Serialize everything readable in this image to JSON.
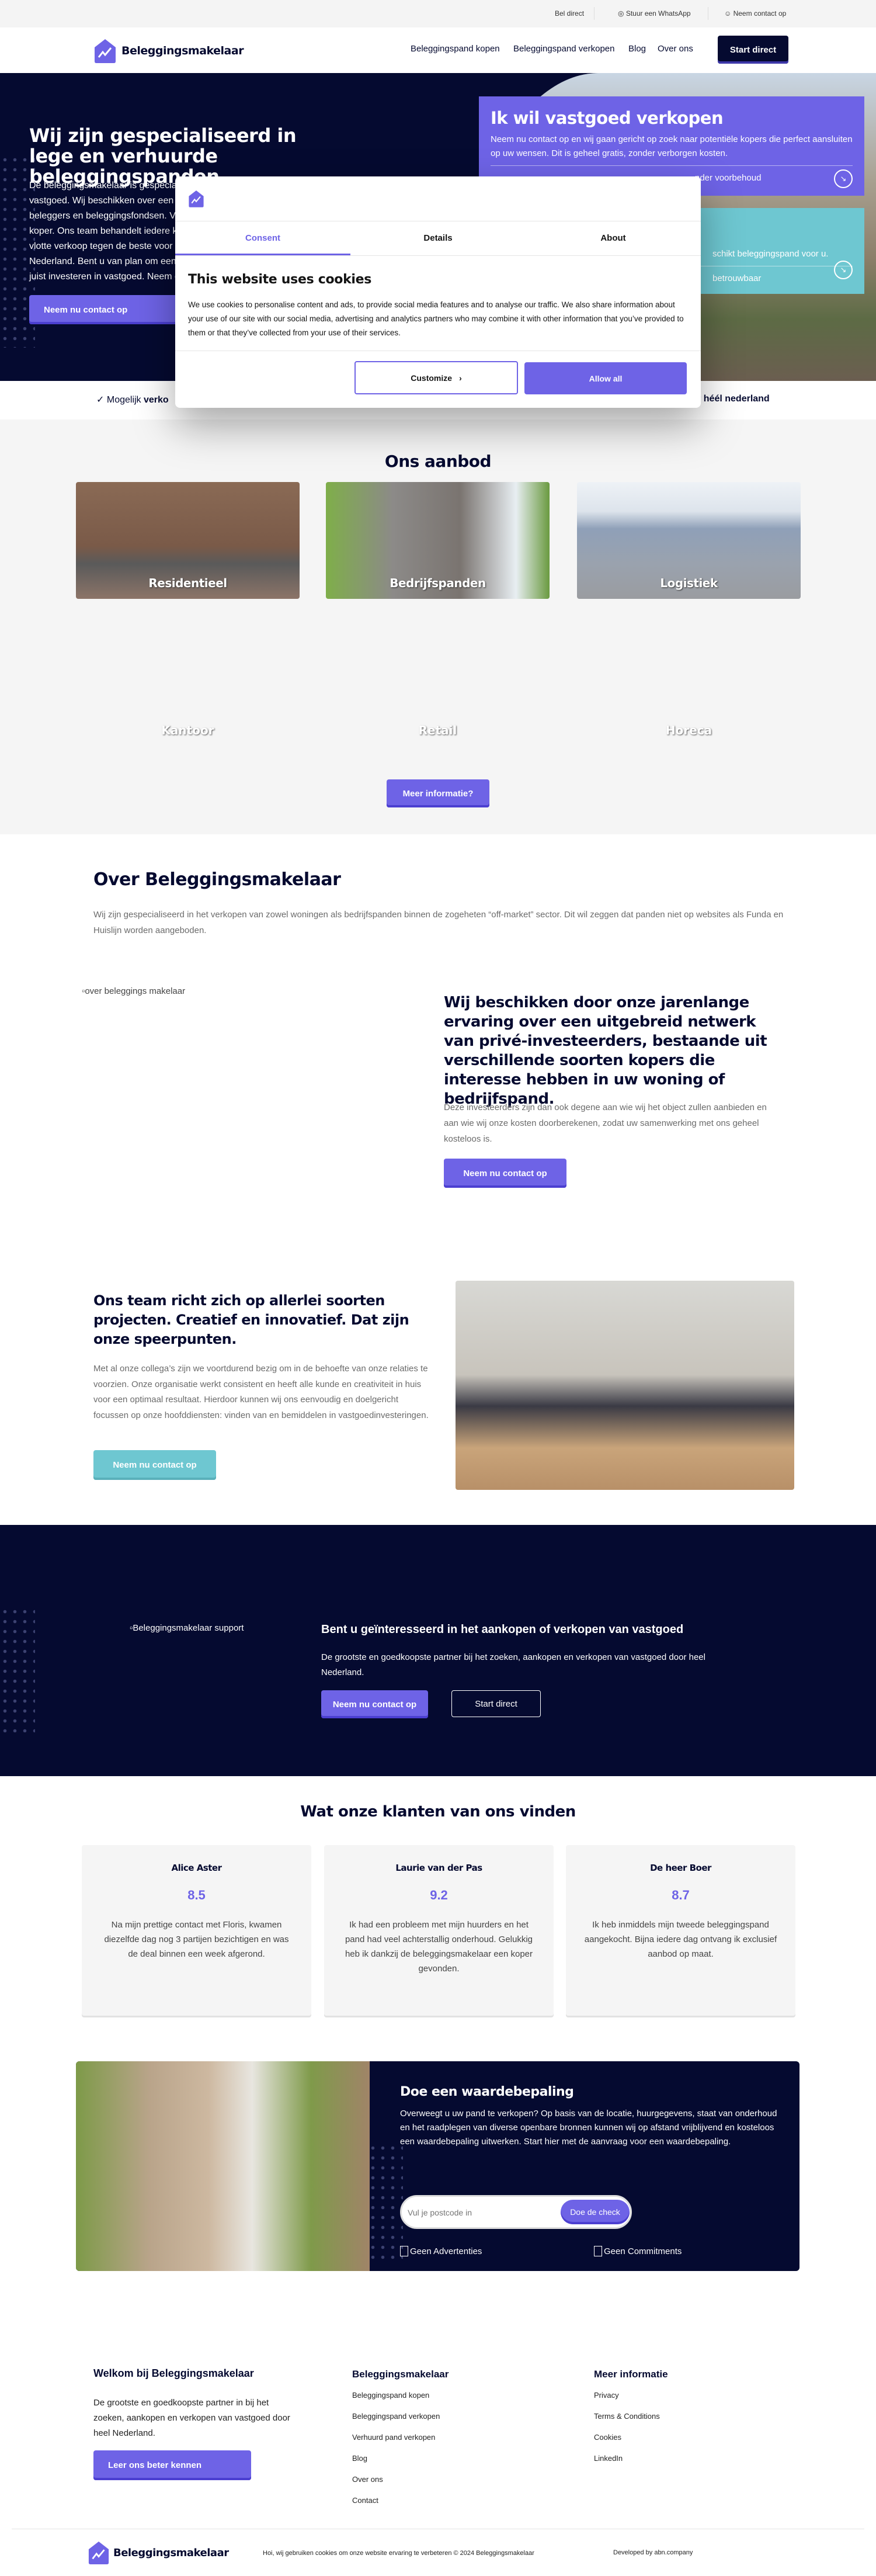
{
  "topbar": {
    "call": "Bel direct",
    "whatsapp": "Stuur een WhatsApp",
    "contact": "Neem contact op"
  },
  "nav": {
    "brand": "Beleggingsmakelaar",
    "links": [
      "Beleggingspand kopen",
      "Beleggingspand verkopen",
      "Blog",
      "Over ons"
    ],
    "cta": "Start direct"
  },
  "hero": {
    "title": "Wij zijn gespecialiseerd in lege en verhuurde beleggingspanden",
    "lines": [
      "De beleggingsmakelaar is gespecial",
      "vastgoed. Wij beschikken over een g",
      "beleggers en beleggingsfondsen. V",
      "koper. Ons team behandelt iedere k",
      "vlotte verkoop tegen de beste voor",
      "Nederland. Bent u van plan om een",
      "juist investeren in vastgoed. Neem c"
    ],
    "button": "Neem nu contact op",
    "sell": {
      "title": "Ik wil vastgoed verkopen",
      "text": "Neem nu contact op en wij gaan gericht op zoek naar potentiële kopers die perfect aansluiten op uw wensen. Dit is geheel gratis, zonder verborgen kosten.",
      "link": "nder voorbehoud"
    },
    "buy": {
      "text": "schikt beleggingspand voor u.",
      "link": "betrouwbaar"
    },
    "strip_left_a": "Mogelijk ",
    "strip_left_b": "verko",
    "strip_right_a": "r ",
    "strip_right_b": "héél nederland"
  },
  "aanbod": {
    "title": "Ons aanbod",
    "items": [
      "Residentieel",
      "Bedrijfspanden",
      "Logistiek",
      "Kantoor",
      "Retail",
      "Horeca"
    ],
    "button": "Meer informatie?"
  },
  "about": {
    "title": "Over Beleggingsmakelaar",
    "text": "Wij zijn gespecialiseerd in het verkopen van zowel woningen als bedrijfspanden binnen de zogeheten “off-market” sector. Dit wil zeggen dat panden niet op websites als Funda en Huislijn worden aangeboden.",
    "img_alt": "over beleggings makelaar",
    "heading": "Wij beschikken door onze jarenlange ervaring over een uitgebreid netwerk van privé-investeerders, bestaande uit verschillende soorten kopers die interesse hebben in uw woning of bedrijfspand.",
    "para": "Deze investeerders zijn dan ook degene aan wie wij het object zullen aanbieden en aan wie wij onze kosten doorberekenen, zodat uw samenwerking met ons geheel kosteloos is.",
    "button": "Neem nu contact op"
  },
  "team": {
    "heading": "Ons team richt zich op allerlei soorten projecten. Creatief en innovatief. Dat zijn onze speerpunten.",
    "para": "Met al onze collega’s zijn we voortdurend bezig om in de behoefte van onze relaties te voorzien. Onze organisatie werkt consistent en heeft alle kunde en creativiteit in huis voor een optimaal resultaat. Hierdoor kunnen wij ons eenvoudig en doelgericht focussen op onze hoofddiensten: vinden van en bemiddelen in vastgoedinvesteringen.",
    "button": "Neem nu contact op"
  },
  "cta": {
    "img_alt": "Beleggingsmakelaar support",
    "title": "Bent u geïnteresseerd in het aankopen of verkopen van vastgoed",
    "text": "De grootste en goedkoopste partner bij het zoeken, aankopen en verkopen van vastgoed door heel Nederland.",
    "primary": "Neem nu contact op",
    "secondary": "Start direct"
  },
  "reviews": {
    "title": "Wat onze klanten van ons vinden",
    "items": [
      {
        "name": "Alice Aster",
        "rating": "8.5",
        "text": "Na mijn prettige contact met Floris, kwamen diezelfde dag nog 3 partijen bezichtigen en was de deal binnen een week afgerond."
      },
      {
        "name": "Laurie van der Pas",
        "rating": "9.2",
        "text": "Ik had een probleem met mijn huurders en het pand had veel achterstallig onderhoud. Gelukkig heb ik dankzij de beleggingsmakelaar een koper gevonden."
      },
      {
        "name": "De heer Boer",
        "rating": "8.7",
        "text": "Ik heb inmiddels mijn tweede beleggingspand aangekocht. Bijna iedere dag ontvang ik exclusief aanbod op maat."
      }
    ]
  },
  "valuation": {
    "title": "Doe een waardebepaling",
    "text": "Overweegt u uw pand te verkopen? Op basis van de locatie, huurgegevens, staat van onderhoud en het raadplegen van diverse openbare bronnen kunnen wij op afstand vrijblijvend en kosteloos een waardebepaling uitwerken. Start hier met de aanvraag voor een waardebepaling.",
    "placeholder": "Vul je postcode in",
    "button": "Doe de check",
    "check1": "Geen Advertenties",
    "check2": "Geen Commitments"
  },
  "footer": {
    "welcome_title": "Welkom bij Beleggingsmakelaar",
    "welcome_text": "De grootste en goedkoopste partner in bij het zoeken, aankopen en verkopen van vastgoed door heel Nederland.",
    "welcome_button": "Leer ons beter kennen",
    "col2_title": "Beleggingsmakelaar",
    "col2_links": [
      "Beleggingspand kopen",
      "Beleggingspand verkopen",
      "Verhuurd pand verkopen",
      "Blog",
      "Over ons",
      "Contact"
    ],
    "col3_title": "Meer informatie",
    "col3_links": [
      "Privacy",
      "Terms & Conditions",
      "Cookies",
      "LinkedIn"
    ],
    "brand": "Beleggingsmakelaar",
    "cookie_note": "Hoi, wij gebruiken cookies om onze website ervaring te verbeteren © 2024 Beleggingsmakelaar",
    "developed": "Developed by abn.company"
  },
  "cookie": {
    "tabs": [
      "Consent",
      "Details",
      "About"
    ],
    "title": "This website uses cookies",
    "text": "We use cookies to personalise content and ads, to provide social media features and to analyse our traffic. We also share information about your use of our site with our social media, advertising and analytics partners who may combine it with other information that you’ve provided to them or that they’ve collected from your use of their services.",
    "customize": "Customize",
    "allow": "Allow all"
  },
  "colors": {
    "navy": "#050a30",
    "purple": "#6e63e6",
    "teal": "#6ec7d1"
  }
}
